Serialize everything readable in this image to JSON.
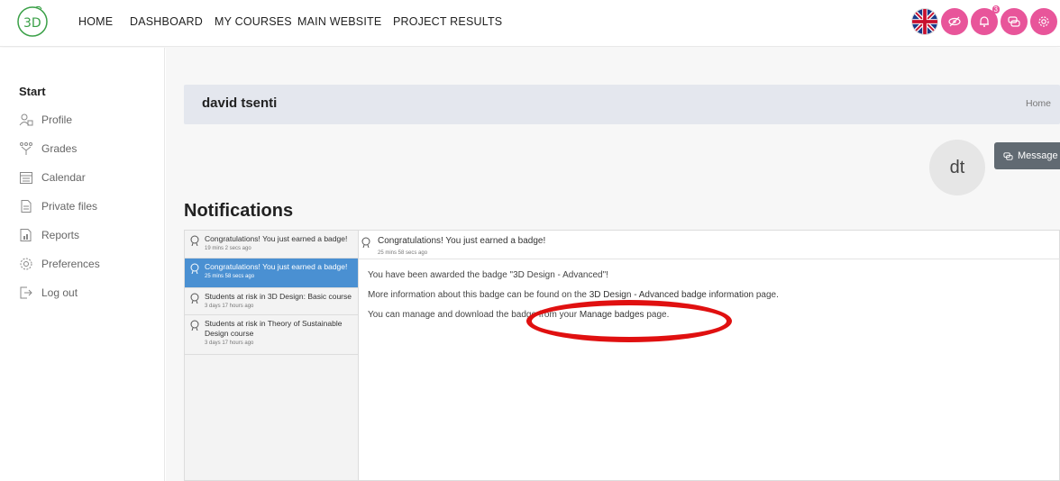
{
  "navbar": {
    "links": [
      "HOME",
      "DASHBOARD",
      "MY COURSES",
      "MAIN WEBSITE",
      "PROJECT RESULTS"
    ],
    "notification_count": "3",
    "accent": "#e8559a"
  },
  "sidebar": {
    "title": "Start",
    "items": [
      {
        "label": "Profile",
        "icon": "profile-icon"
      },
      {
        "label": "Grades",
        "icon": "grades-icon"
      },
      {
        "label": "Calendar",
        "icon": "calendar-icon"
      },
      {
        "label": "Private files",
        "icon": "file-icon"
      },
      {
        "label": "Reports",
        "icon": "reports-icon"
      },
      {
        "label": "Preferences",
        "icon": "gear-icon"
      },
      {
        "label": "Log out",
        "icon": "logout-icon"
      }
    ]
  },
  "header": {
    "name": "david tsenti",
    "breadcrumb": "Home"
  },
  "profile": {
    "avatar_initials": "dt",
    "message_label": "Message"
  },
  "notifications": {
    "title": "Notifications",
    "list": [
      {
        "text": "Congratulations! You just earned a badge!",
        "time": "19 mins 2 secs ago",
        "active": false
      },
      {
        "text": "Congratulations! You just earned a badge!",
        "time": "25 mins 58 secs ago",
        "active": true
      },
      {
        "text": "Students at risk in 3D Design: Basic course",
        "time": "3 days 17 hours ago",
        "active": false
      },
      {
        "text": "Students at risk in Theory of Sustainable Design course",
        "time": "3 days 17 hours ago",
        "active": false
      }
    ],
    "detail": {
      "subject": "Congratulations! You just earned a badge!",
      "time": "25 mins 58 secs ago",
      "line1": "You have been awarded the badge \"3D Design - Advanced\"!",
      "line2_pre": "More information about this badge can be found on the ",
      "line2_link": "3D Design - Advanced badge information",
      "line2_post": " page.",
      "line3_pre": "You can manage and download the badge from your ",
      "line3_link": "Manage badges",
      "line3_post": " page."
    }
  }
}
